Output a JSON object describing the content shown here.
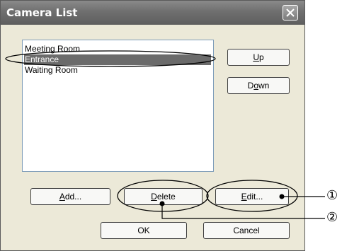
{
  "window": {
    "title": "Camera List",
    "close_icon": "close-icon"
  },
  "camera_list": {
    "items": [
      {
        "label": "Meeting Room",
        "selected": false
      },
      {
        "label": "Entrance",
        "selected": true
      },
      {
        "label": "Waiting Room",
        "selected": false
      }
    ]
  },
  "buttons": {
    "up": {
      "mnemonic": "U",
      "rest": "p"
    },
    "down": {
      "pre": "D",
      "mnemonic": "o",
      "rest": "wn"
    },
    "add": {
      "mnemonic": "A",
      "rest": "dd..."
    },
    "delete": {
      "mnemonic": "D",
      "rest": "elete"
    },
    "edit": {
      "mnemonic": "E",
      "rest": "dit..."
    },
    "ok": "OK",
    "cancel": "Cancel"
  },
  "callouts": {
    "one": "①",
    "two": "②"
  },
  "colors": {
    "titlebar": "#6f6f6f",
    "dialog_bg": "#ece9d8",
    "selection": "#6b6b6b"
  }
}
